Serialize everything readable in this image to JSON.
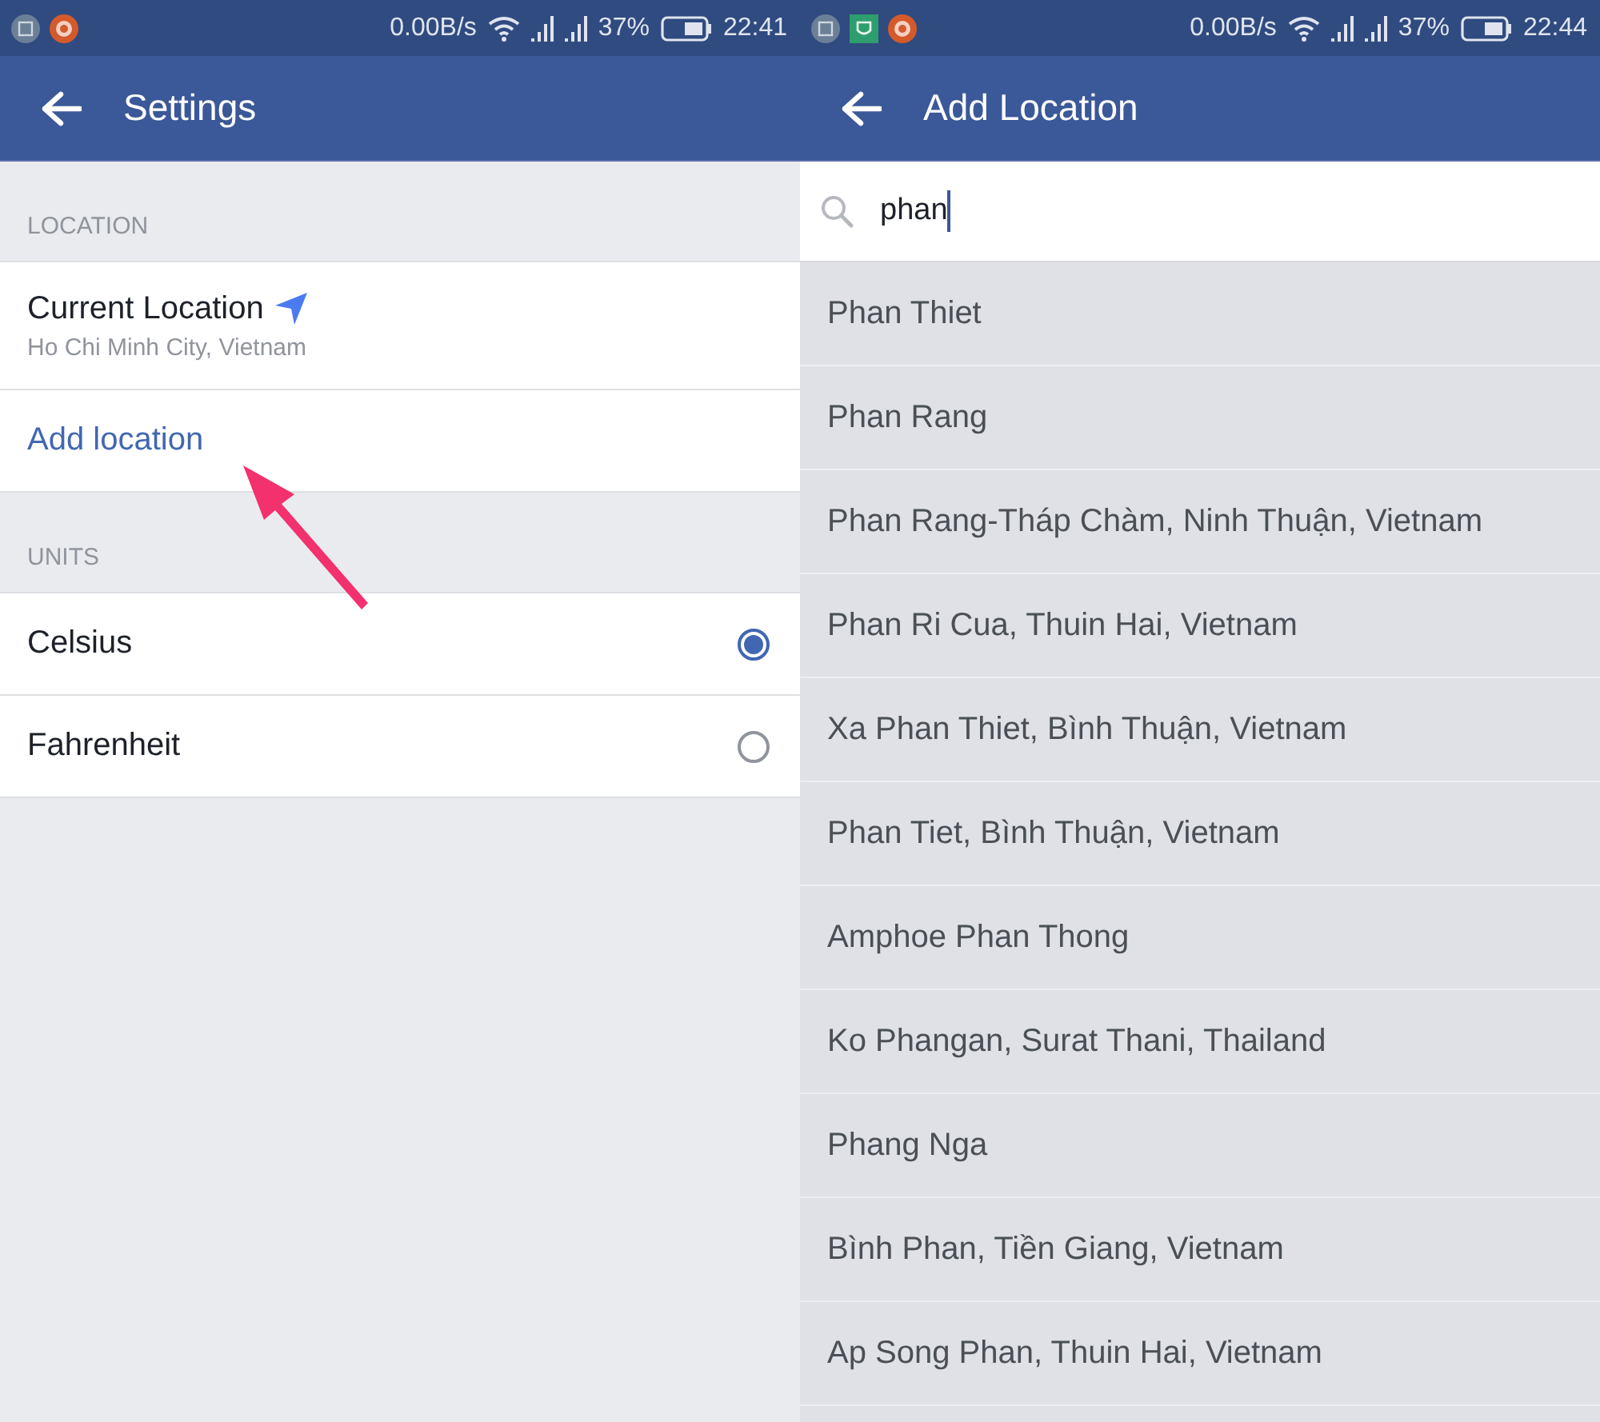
{
  "screens": [
    {
      "status_bar": {
        "notifications": [
          {
            "kind": "gallery"
          },
          {
            "kind": "flower"
          }
        ],
        "speed": "0.00B/s",
        "battery": "37%",
        "time": "22:41"
      },
      "app_bar": {
        "title": "Settings"
      },
      "sections": [
        {
          "header": "LOCATION",
          "items": [
            {
              "kind": "location",
              "title": "Current Location",
              "subtitle": "Ho Chi Minh City, Vietnam"
            },
            {
              "kind": "link",
              "label": "Add location"
            }
          ]
        },
        {
          "header": "UNITS",
          "items": [
            {
              "kind": "radio",
              "label": "Celsius",
              "selected": true
            },
            {
              "kind": "radio",
              "label": "Fahrenheit",
              "selected": false
            }
          ]
        }
      ]
    },
    {
      "status_bar": {
        "notifications": [
          {
            "kind": "gallery"
          },
          {
            "kind": "shield"
          },
          {
            "kind": "flower"
          }
        ],
        "speed": "0.00B/s",
        "battery": "37%",
        "time": "22:44"
      },
      "app_bar": {
        "title": "Add Location"
      },
      "search": {
        "value": "phan"
      },
      "results": [
        "Phan Thiet",
        "Phan Rang",
        "Phan Rang-Tháp Chàm, Ninh Thuận, Vietnam",
        "Phan Ri Cua, Thuin Hai, Vietnam",
        "Xa Phan Thiet, Bình Thuận, Vietnam",
        "Phan Tiet, Bình Thuận, Vietnam",
        "Amphoe Phan Thong",
        "Ko Phangan, Surat Thani, Thailand",
        "Phang Nga",
        "Bình Phan, Tiền Giang, Vietnam",
        "Ap Song Phan, Thuin Hai, Vietnam"
      ]
    }
  ]
}
